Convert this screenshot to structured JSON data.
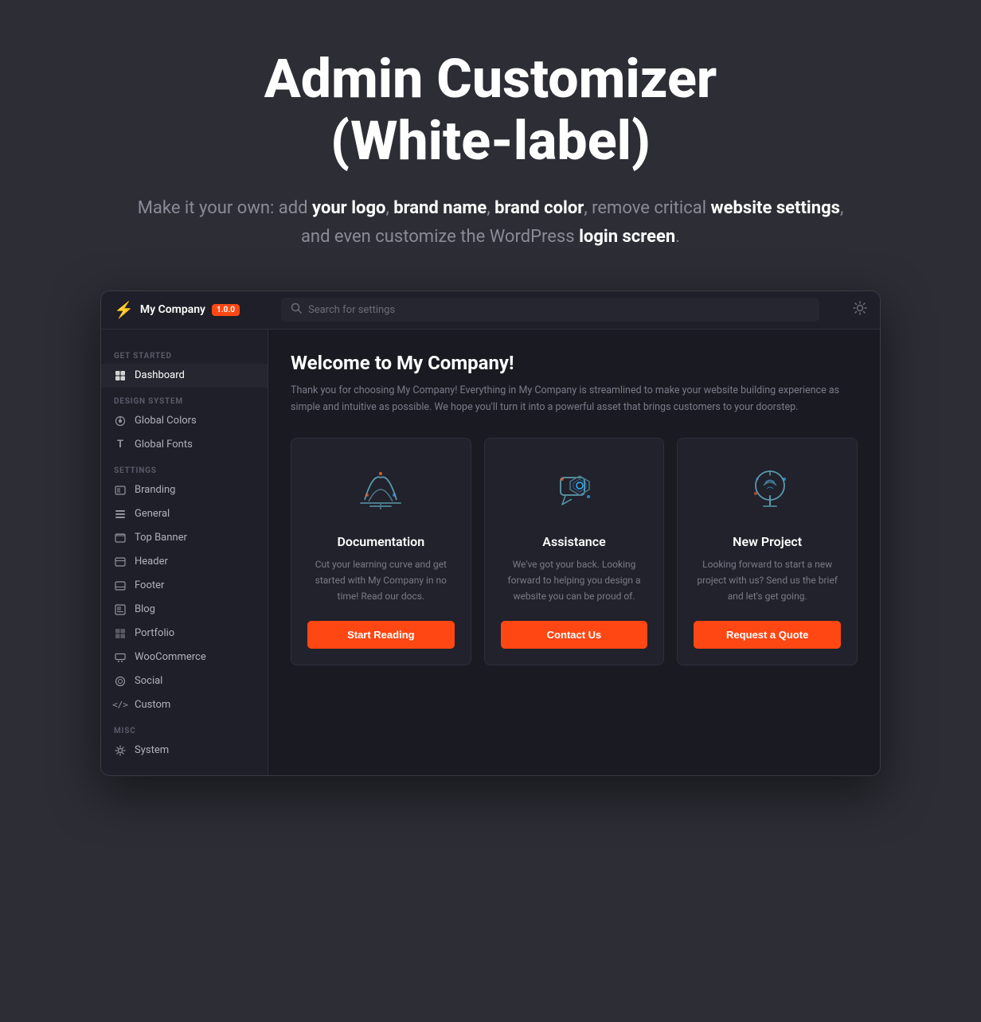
{
  "page": {
    "title": "Admin Customizer\n(White-label)",
    "subtitle_plain": "Make it your own: add ",
    "subtitle_bold1": "your logo",
    "subtitle_sep1": ", ",
    "subtitle_bold2": "brand name",
    "subtitle_sep2": ", ",
    "subtitle_bold3": "brand color",
    "subtitle_mid": ", remove critical ",
    "subtitle_bold4": "website settings",
    "subtitle_end": ", and even customize the WordPress ",
    "subtitle_bold5": "login screen",
    "subtitle_period": "."
  },
  "topbar": {
    "logo_icon": "⚡",
    "logo_text": "My Company",
    "version": "1.0.0",
    "search_placeholder": "Search for settings"
  },
  "sidebar": {
    "sections": [
      {
        "label": "GET STARTED",
        "items": [
          {
            "icon": "⊞",
            "label": "Dashboard",
            "active": true
          }
        ]
      },
      {
        "label": "DESIGN SYSTEM",
        "items": [
          {
            "icon": "◈",
            "label": "Global Colors"
          },
          {
            "icon": "T",
            "label": "Global Fonts"
          }
        ]
      },
      {
        "label": "SETTINGS",
        "items": [
          {
            "icon": "▣",
            "label": "Branding"
          },
          {
            "icon": "⊟",
            "label": "General"
          },
          {
            "icon": "▤",
            "label": "Top Banner"
          },
          {
            "icon": "▢",
            "label": "Header"
          },
          {
            "icon": "▢",
            "label": "Footer"
          },
          {
            "icon": "▣",
            "label": "Blog"
          },
          {
            "icon": "⊞",
            "label": "Portfolio"
          },
          {
            "icon": "🛍",
            "label": "WooCommerce"
          },
          {
            "icon": "◎",
            "label": "Social"
          },
          {
            "icon": "</>",
            "label": "Custom"
          }
        ]
      },
      {
        "label": "MISC",
        "items": [
          {
            "icon": "⚙",
            "label": "System"
          }
        ]
      }
    ]
  },
  "content": {
    "welcome_title": "Welcome to My Company!",
    "welcome_text": "Thank you for choosing My Company! Everything in My Company is streamlined to make your website building experience as simple and intuitive as possible. We hope you'll turn it into a powerful asset that brings customers to your doorstep.",
    "cards": [
      {
        "id": "documentation",
        "title": "Documentation",
        "desc": "Cut your learning curve and get started with My Company in no time! Read our docs.",
        "btn_label": "Start Reading"
      },
      {
        "id": "assistance",
        "title": "Assistance",
        "desc": "We've got your back. Looking forward to helping you design a website you can be proud of.",
        "btn_label": "Contact Us"
      },
      {
        "id": "new-project",
        "title": "New Project",
        "desc": "Looking forward to start a new project with us? Send us the brief and let's get going.",
        "btn_label": "Request a Quote"
      }
    ]
  },
  "colors": {
    "accent": "#ff4713",
    "bg_dark": "#2c2d35",
    "bg_panel": "#1e1f28",
    "bg_card": "#21222c",
    "text_primary": "#ffffff",
    "text_muted": "#7a7b88"
  }
}
